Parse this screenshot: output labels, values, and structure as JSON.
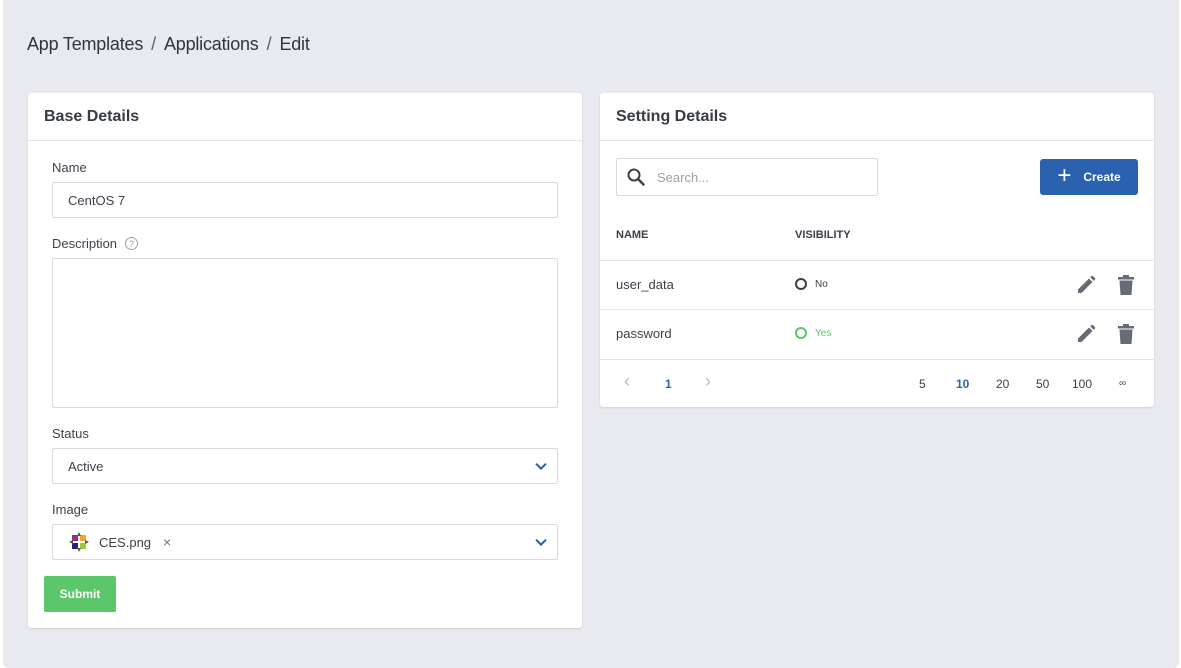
{
  "breadcrumb": {
    "part1": "App Templates",
    "sep": "/",
    "part2": "Applications",
    "part3": "Edit"
  },
  "base": {
    "title": "Base Details",
    "name_label": "Name",
    "name_value": "CentOS 7",
    "description_label": "Description",
    "description_help": "?",
    "description_value": "",
    "status_label": "Status",
    "status_value": "Active",
    "image_label": "Image",
    "image_value": "CES.png",
    "image_remove": "×",
    "submit_label": "Submit"
  },
  "setting": {
    "title": "Setting Details",
    "search_placeholder": "Search...",
    "create_label": "Create",
    "create_plus": "+",
    "columns": {
      "name": "NAME",
      "visibility": "VISIBILITY"
    },
    "rows": [
      {
        "name": "user_data",
        "visibility": "No"
      },
      {
        "name": "password",
        "visibility": "Yes"
      }
    ],
    "pagination": {
      "prev": "‹",
      "current_page": "1",
      "next": "›",
      "sizes": [
        "5",
        "10",
        "20",
        "50",
        "100",
        "∞"
      ],
      "selected_size": "10"
    }
  },
  "colors": {
    "accent": "#2a62b0",
    "success": "#5cc66a",
    "background": "#e9eaef"
  }
}
